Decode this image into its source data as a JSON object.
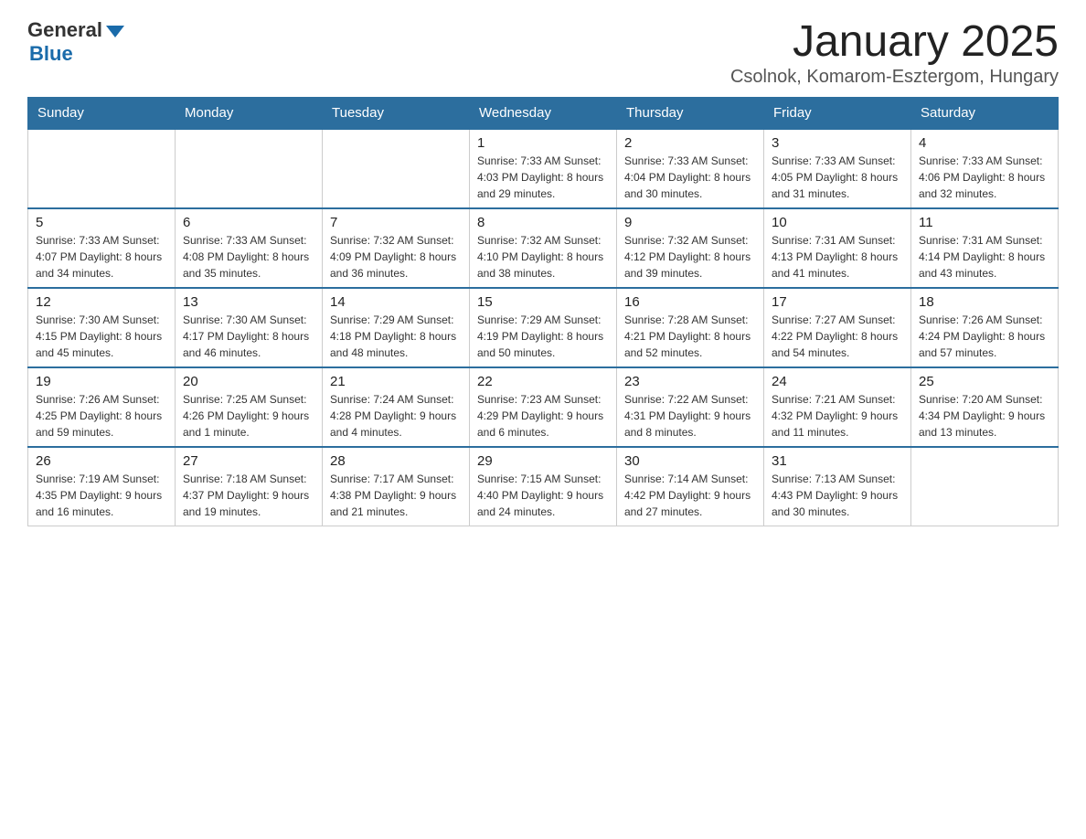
{
  "header": {
    "logo": {
      "text_general": "General",
      "text_blue": "Blue",
      "icon_alt": "triangle icon"
    },
    "title": "January 2025",
    "subtitle": "Csolnok, Komarom-Esztergom, Hungary"
  },
  "calendar": {
    "days_of_week": [
      "Sunday",
      "Monday",
      "Tuesday",
      "Wednesday",
      "Thursday",
      "Friday",
      "Saturday"
    ],
    "weeks": [
      [
        {
          "day": "",
          "info": ""
        },
        {
          "day": "",
          "info": ""
        },
        {
          "day": "",
          "info": ""
        },
        {
          "day": "1",
          "info": "Sunrise: 7:33 AM\nSunset: 4:03 PM\nDaylight: 8 hours\nand 29 minutes."
        },
        {
          "day": "2",
          "info": "Sunrise: 7:33 AM\nSunset: 4:04 PM\nDaylight: 8 hours\nand 30 minutes."
        },
        {
          "day": "3",
          "info": "Sunrise: 7:33 AM\nSunset: 4:05 PM\nDaylight: 8 hours\nand 31 minutes."
        },
        {
          "day": "4",
          "info": "Sunrise: 7:33 AM\nSunset: 4:06 PM\nDaylight: 8 hours\nand 32 minutes."
        }
      ],
      [
        {
          "day": "5",
          "info": "Sunrise: 7:33 AM\nSunset: 4:07 PM\nDaylight: 8 hours\nand 34 minutes."
        },
        {
          "day": "6",
          "info": "Sunrise: 7:33 AM\nSunset: 4:08 PM\nDaylight: 8 hours\nand 35 minutes."
        },
        {
          "day": "7",
          "info": "Sunrise: 7:32 AM\nSunset: 4:09 PM\nDaylight: 8 hours\nand 36 minutes."
        },
        {
          "day": "8",
          "info": "Sunrise: 7:32 AM\nSunset: 4:10 PM\nDaylight: 8 hours\nand 38 minutes."
        },
        {
          "day": "9",
          "info": "Sunrise: 7:32 AM\nSunset: 4:12 PM\nDaylight: 8 hours\nand 39 minutes."
        },
        {
          "day": "10",
          "info": "Sunrise: 7:31 AM\nSunset: 4:13 PM\nDaylight: 8 hours\nand 41 minutes."
        },
        {
          "day": "11",
          "info": "Sunrise: 7:31 AM\nSunset: 4:14 PM\nDaylight: 8 hours\nand 43 minutes."
        }
      ],
      [
        {
          "day": "12",
          "info": "Sunrise: 7:30 AM\nSunset: 4:15 PM\nDaylight: 8 hours\nand 45 minutes."
        },
        {
          "day": "13",
          "info": "Sunrise: 7:30 AM\nSunset: 4:17 PM\nDaylight: 8 hours\nand 46 minutes."
        },
        {
          "day": "14",
          "info": "Sunrise: 7:29 AM\nSunset: 4:18 PM\nDaylight: 8 hours\nand 48 minutes."
        },
        {
          "day": "15",
          "info": "Sunrise: 7:29 AM\nSunset: 4:19 PM\nDaylight: 8 hours\nand 50 minutes."
        },
        {
          "day": "16",
          "info": "Sunrise: 7:28 AM\nSunset: 4:21 PM\nDaylight: 8 hours\nand 52 minutes."
        },
        {
          "day": "17",
          "info": "Sunrise: 7:27 AM\nSunset: 4:22 PM\nDaylight: 8 hours\nand 54 minutes."
        },
        {
          "day": "18",
          "info": "Sunrise: 7:26 AM\nSunset: 4:24 PM\nDaylight: 8 hours\nand 57 minutes."
        }
      ],
      [
        {
          "day": "19",
          "info": "Sunrise: 7:26 AM\nSunset: 4:25 PM\nDaylight: 8 hours\nand 59 minutes."
        },
        {
          "day": "20",
          "info": "Sunrise: 7:25 AM\nSunset: 4:26 PM\nDaylight: 9 hours\nand 1 minute."
        },
        {
          "day": "21",
          "info": "Sunrise: 7:24 AM\nSunset: 4:28 PM\nDaylight: 9 hours\nand 4 minutes."
        },
        {
          "day": "22",
          "info": "Sunrise: 7:23 AM\nSunset: 4:29 PM\nDaylight: 9 hours\nand 6 minutes."
        },
        {
          "day": "23",
          "info": "Sunrise: 7:22 AM\nSunset: 4:31 PM\nDaylight: 9 hours\nand 8 minutes."
        },
        {
          "day": "24",
          "info": "Sunrise: 7:21 AM\nSunset: 4:32 PM\nDaylight: 9 hours\nand 11 minutes."
        },
        {
          "day": "25",
          "info": "Sunrise: 7:20 AM\nSunset: 4:34 PM\nDaylight: 9 hours\nand 13 minutes."
        }
      ],
      [
        {
          "day": "26",
          "info": "Sunrise: 7:19 AM\nSunset: 4:35 PM\nDaylight: 9 hours\nand 16 minutes."
        },
        {
          "day": "27",
          "info": "Sunrise: 7:18 AM\nSunset: 4:37 PM\nDaylight: 9 hours\nand 19 minutes."
        },
        {
          "day": "28",
          "info": "Sunrise: 7:17 AM\nSunset: 4:38 PM\nDaylight: 9 hours\nand 21 minutes."
        },
        {
          "day": "29",
          "info": "Sunrise: 7:15 AM\nSunset: 4:40 PM\nDaylight: 9 hours\nand 24 minutes."
        },
        {
          "day": "30",
          "info": "Sunrise: 7:14 AM\nSunset: 4:42 PM\nDaylight: 9 hours\nand 27 minutes."
        },
        {
          "day": "31",
          "info": "Sunrise: 7:13 AM\nSunset: 4:43 PM\nDaylight: 9 hours\nand 30 minutes."
        },
        {
          "day": "",
          "info": ""
        }
      ]
    ]
  }
}
